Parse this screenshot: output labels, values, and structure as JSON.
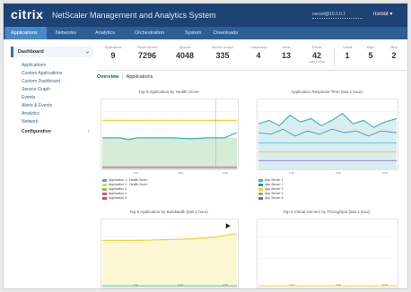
{
  "header": {
    "logo": "citrix",
    "title": "NetScaler Management and Analytics System",
    "user_field": "nsroot@10.0.0.1",
    "admin_label": "nsroot ▾"
  },
  "nav": {
    "tabs": [
      {
        "label": "Applications",
        "active": true
      },
      {
        "label": "Networks",
        "active": false
      },
      {
        "label": "Analytics",
        "active": false
      },
      {
        "label": "Orchestration",
        "active": false
      },
      {
        "label": "System",
        "active": false
      },
      {
        "label": "Downloads",
        "active": false
      }
    ]
  },
  "sidebar": {
    "header": "Dashboard",
    "items": [
      "Applications",
      "Custom Applications",
      "Custom Dashboard",
      "Service Graph",
      "Events",
      "Alerts & Events",
      "Analytics",
      "Network"
    ],
    "category": "Configuration"
  },
  "stats": [
    {
      "label": "Applications",
      "value": "9",
      "sub": ""
    },
    {
      "label": "Virtual Servers",
      "value": "7296",
      "sub": ""
    },
    {
      "label": "Services",
      "value": "4048",
      "sub": ""
    },
    {
      "label": "Service Groups",
      "value": "335",
      "sub": ""
    },
    {
      "label": "Critical Apps",
      "value": "4",
      "sub": ""
    },
    {
      "label": "Alerts",
      "value": "13",
      "sub": ""
    },
    {
      "label": "Events",
      "value": "42",
      "sub": "Last 1 Hour"
    },
    {
      "label": "Critical",
      "value": "1",
      "sub": ""
    },
    {
      "label": "Major",
      "value": "5",
      "sub": ""
    },
    {
      "label": "Minor",
      "value": "2",
      "sub": ""
    }
  ],
  "subtabs": {
    "active": "Overview",
    "other": "Applications"
  },
  "charts": [
    {
      "title": "Top 5 Application by Health Score",
      "legend": [
        "Application 1 - Health Score",
        "Application 2 - Health Score",
        "Application 3",
        "Application 4",
        "Application 5"
      ],
      "xticks": [
        "1:00",
        "2:00",
        "3:00"
      ]
    },
    {
      "title": "Application Response Time (last 1 hour)",
      "legend": [
        "App Server 1",
        "App Server 2",
        "App Server 3",
        "App Server 4",
        "App Server 5"
      ],
      "xticks": [
        "1:00",
        "2:00",
        "3:00"
      ]
    },
    {
      "title": "Top 5 Application by Bandwidth (last 1 hour)",
      "legend": [],
      "xticks": [
        "1:00",
        "2:00",
        "3:00"
      ]
    },
    {
      "title": "Top 5 Virtual Servers by Throughput (last 1 hour)",
      "legend": [],
      "xticks": [
        "1:00",
        "2:00",
        "3:00"
      ]
    }
  ],
  "colors": {
    "topbar": "#1c4373",
    "navbar": "#2d5f96",
    "active_tab": "#4a87c5",
    "teal": "#3ab5c6",
    "yellow": "#f2d43c",
    "green_fill": "#d6ecd6",
    "teal_fill": "#d9eef0",
    "yellow_fill": "#fbf6d4"
  }
}
